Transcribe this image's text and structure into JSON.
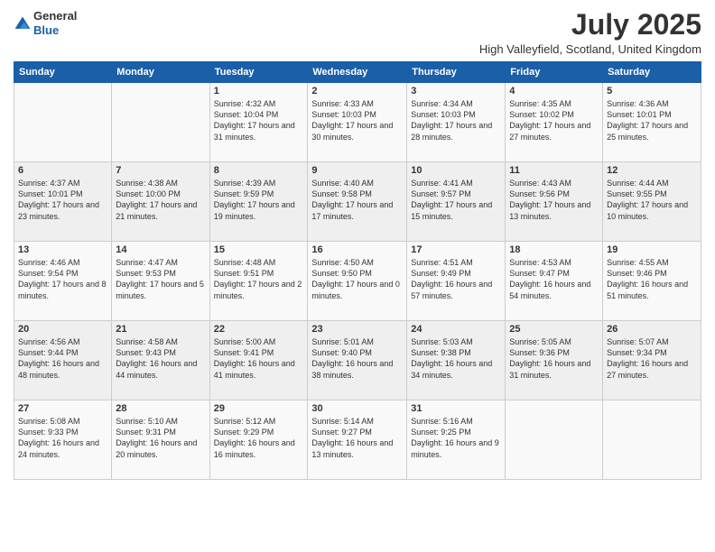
{
  "header": {
    "logo_line1": "General",
    "logo_line2": "Blue",
    "title": "July 2025",
    "subtitle": "High Valleyfield, Scotland, United Kingdom"
  },
  "columns": [
    "Sunday",
    "Monday",
    "Tuesday",
    "Wednesday",
    "Thursday",
    "Friday",
    "Saturday"
  ],
  "weeks": [
    [
      {
        "day": "",
        "sunrise": "",
        "sunset": "",
        "daylight": ""
      },
      {
        "day": "",
        "sunrise": "",
        "sunset": "",
        "daylight": ""
      },
      {
        "day": "1",
        "sunrise": "Sunrise: 4:32 AM",
        "sunset": "Sunset: 10:04 PM",
        "daylight": "Daylight: 17 hours and 31 minutes."
      },
      {
        "day": "2",
        "sunrise": "Sunrise: 4:33 AM",
        "sunset": "Sunset: 10:03 PM",
        "daylight": "Daylight: 17 hours and 30 minutes."
      },
      {
        "day": "3",
        "sunrise": "Sunrise: 4:34 AM",
        "sunset": "Sunset: 10:03 PM",
        "daylight": "Daylight: 17 hours and 28 minutes."
      },
      {
        "day": "4",
        "sunrise": "Sunrise: 4:35 AM",
        "sunset": "Sunset: 10:02 PM",
        "daylight": "Daylight: 17 hours and 27 minutes."
      },
      {
        "day": "5",
        "sunrise": "Sunrise: 4:36 AM",
        "sunset": "Sunset: 10:01 PM",
        "daylight": "Daylight: 17 hours and 25 minutes."
      }
    ],
    [
      {
        "day": "6",
        "sunrise": "Sunrise: 4:37 AM",
        "sunset": "Sunset: 10:01 PM",
        "daylight": "Daylight: 17 hours and 23 minutes."
      },
      {
        "day": "7",
        "sunrise": "Sunrise: 4:38 AM",
        "sunset": "Sunset: 10:00 PM",
        "daylight": "Daylight: 17 hours and 21 minutes."
      },
      {
        "day": "8",
        "sunrise": "Sunrise: 4:39 AM",
        "sunset": "Sunset: 9:59 PM",
        "daylight": "Daylight: 17 hours and 19 minutes."
      },
      {
        "day": "9",
        "sunrise": "Sunrise: 4:40 AM",
        "sunset": "Sunset: 9:58 PM",
        "daylight": "Daylight: 17 hours and 17 minutes."
      },
      {
        "day": "10",
        "sunrise": "Sunrise: 4:41 AM",
        "sunset": "Sunset: 9:57 PM",
        "daylight": "Daylight: 17 hours and 15 minutes."
      },
      {
        "day": "11",
        "sunrise": "Sunrise: 4:43 AM",
        "sunset": "Sunset: 9:56 PM",
        "daylight": "Daylight: 17 hours and 13 minutes."
      },
      {
        "day": "12",
        "sunrise": "Sunrise: 4:44 AM",
        "sunset": "Sunset: 9:55 PM",
        "daylight": "Daylight: 17 hours and 10 minutes."
      }
    ],
    [
      {
        "day": "13",
        "sunrise": "Sunrise: 4:46 AM",
        "sunset": "Sunset: 9:54 PM",
        "daylight": "Daylight: 17 hours and 8 minutes."
      },
      {
        "day": "14",
        "sunrise": "Sunrise: 4:47 AM",
        "sunset": "Sunset: 9:53 PM",
        "daylight": "Daylight: 17 hours and 5 minutes."
      },
      {
        "day": "15",
        "sunrise": "Sunrise: 4:48 AM",
        "sunset": "Sunset: 9:51 PM",
        "daylight": "Daylight: 17 hours and 2 minutes."
      },
      {
        "day": "16",
        "sunrise": "Sunrise: 4:50 AM",
        "sunset": "Sunset: 9:50 PM",
        "daylight": "Daylight: 17 hours and 0 minutes."
      },
      {
        "day": "17",
        "sunrise": "Sunrise: 4:51 AM",
        "sunset": "Sunset: 9:49 PM",
        "daylight": "Daylight: 16 hours and 57 minutes."
      },
      {
        "day": "18",
        "sunrise": "Sunrise: 4:53 AM",
        "sunset": "Sunset: 9:47 PM",
        "daylight": "Daylight: 16 hours and 54 minutes."
      },
      {
        "day": "19",
        "sunrise": "Sunrise: 4:55 AM",
        "sunset": "Sunset: 9:46 PM",
        "daylight": "Daylight: 16 hours and 51 minutes."
      }
    ],
    [
      {
        "day": "20",
        "sunrise": "Sunrise: 4:56 AM",
        "sunset": "Sunset: 9:44 PM",
        "daylight": "Daylight: 16 hours and 48 minutes."
      },
      {
        "day": "21",
        "sunrise": "Sunrise: 4:58 AM",
        "sunset": "Sunset: 9:43 PM",
        "daylight": "Daylight: 16 hours and 44 minutes."
      },
      {
        "day": "22",
        "sunrise": "Sunrise: 5:00 AM",
        "sunset": "Sunset: 9:41 PM",
        "daylight": "Daylight: 16 hours and 41 minutes."
      },
      {
        "day": "23",
        "sunrise": "Sunrise: 5:01 AM",
        "sunset": "Sunset: 9:40 PM",
        "daylight": "Daylight: 16 hours and 38 minutes."
      },
      {
        "day": "24",
        "sunrise": "Sunrise: 5:03 AM",
        "sunset": "Sunset: 9:38 PM",
        "daylight": "Daylight: 16 hours and 34 minutes."
      },
      {
        "day": "25",
        "sunrise": "Sunrise: 5:05 AM",
        "sunset": "Sunset: 9:36 PM",
        "daylight": "Daylight: 16 hours and 31 minutes."
      },
      {
        "day": "26",
        "sunrise": "Sunrise: 5:07 AM",
        "sunset": "Sunset: 9:34 PM",
        "daylight": "Daylight: 16 hours and 27 minutes."
      }
    ],
    [
      {
        "day": "27",
        "sunrise": "Sunrise: 5:08 AM",
        "sunset": "Sunset: 9:33 PM",
        "daylight": "Daylight: 16 hours and 24 minutes."
      },
      {
        "day": "28",
        "sunrise": "Sunrise: 5:10 AM",
        "sunset": "Sunset: 9:31 PM",
        "daylight": "Daylight: 16 hours and 20 minutes."
      },
      {
        "day": "29",
        "sunrise": "Sunrise: 5:12 AM",
        "sunset": "Sunset: 9:29 PM",
        "daylight": "Daylight: 16 hours and 16 minutes."
      },
      {
        "day": "30",
        "sunrise": "Sunrise: 5:14 AM",
        "sunset": "Sunset: 9:27 PM",
        "daylight": "Daylight: 16 hours and 13 minutes."
      },
      {
        "day": "31",
        "sunrise": "Sunrise: 5:16 AM",
        "sunset": "Sunset: 9:25 PM",
        "daylight": "Daylight: 16 hours and 9 minutes."
      },
      {
        "day": "",
        "sunrise": "",
        "sunset": "",
        "daylight": ""
      },
      {
        "day": "",
        "sunrise": "",
        "sunset": "",
        "daylight": ""
      }
    ]
  ]
}
